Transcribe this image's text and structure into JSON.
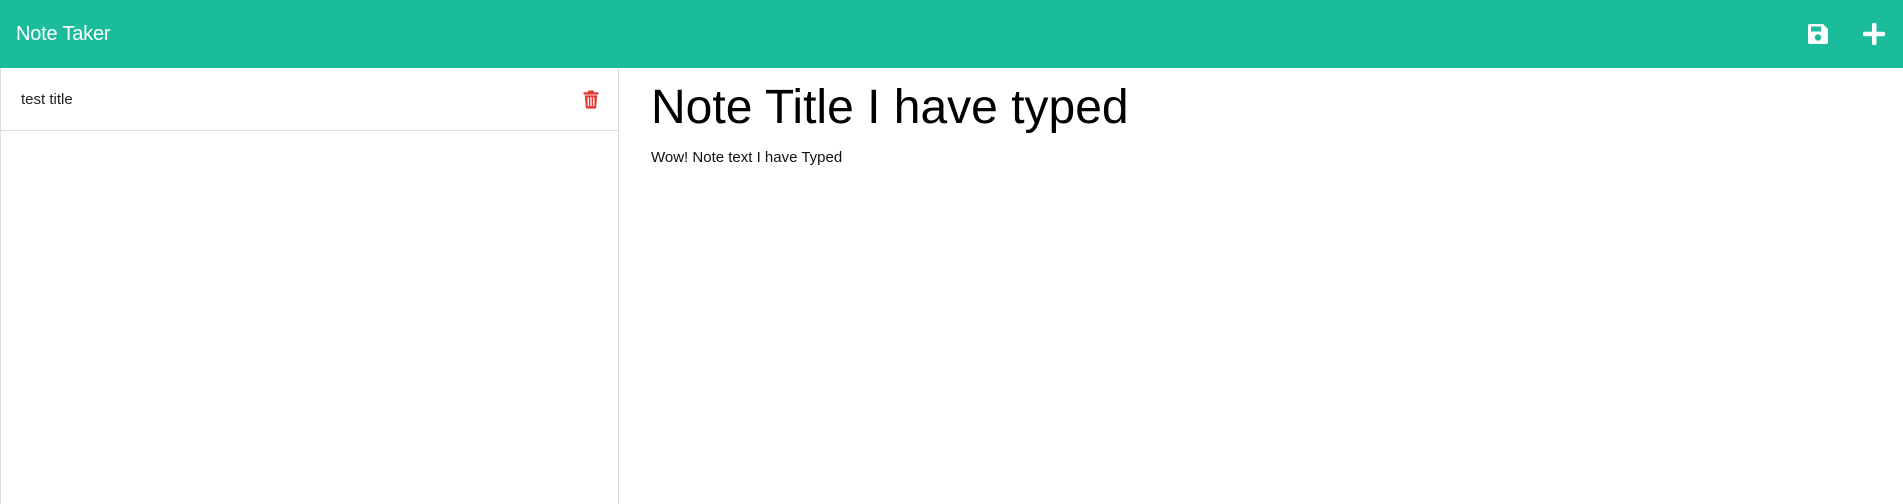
{
  "app": {
    "title": "Note Taker"
  },
  "toolbar": {
    "save_icon": "save-icon",
    "new_icon": "plus-icon"
  },
  "sidebar": {
    "items": [
      {
        "label": "test title",
        "delete_icon": "trash-icon"
      }
    ]
  },
  "editor": {
    "title": "Note Title I have typed",
    "body": "Wow! Note text I have Typed"
  },
  "colors": {
    "navbar": "#1abc9c",
    "delete": "#e53935",
    "text": "#222222"
  }
}
